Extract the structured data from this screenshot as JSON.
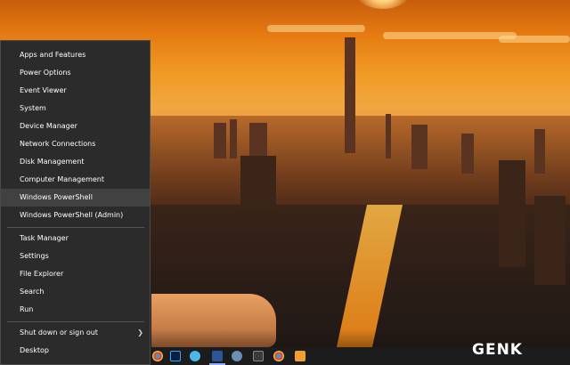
{
  "menu": {
    "items": [
      {
        "label": "Apps and Features"
      },
      {
        "label": "Power Options"
      },
      {
        "label": "Event Viewer"
      },
      {
        "label": "System"
      },
      {
        "label": "Device Manager"
      },
      {
        "label": "Network Connections"
      },
      {
        "label": "Disk Management"
      },
      {
        "label": "Computer Management"
      },
      {
        "label": "Windows PowerShell",
        "highlighted": true
      },
      {
        "label": "Windows PowerShell (Admin)"
      },
      {
        "label": "Task Manager"
      },
      {
        "label": "Settings"
      },
      {
        "label": "File Explorer"
      },
      {
        "label": "Search"
      },
      {
        "label": "Run"
      },
      {
        "label": "Shut down or sign out",
        "has_submenu": true
      },
      {
        "label": "Desktop"
      }
    ]
  },
  "taskbar": {
    "icons": [
      "chrome-icon",
      "photoshop-icon",
      "edge-icon",
      "word-icon",
      "browser-icon",
      "app-icon",
      "chrome-icon",
      "media-icon"
    ]
  },
  "watermark": {
    "text": "GENK"
  },
  "colors": {
    "menu_bg": "#2b2b2b",
    "menu_highlight": "#414141",
    "menu_text": "#ffffff",
    "accent": "#e57a12"
  }
}
